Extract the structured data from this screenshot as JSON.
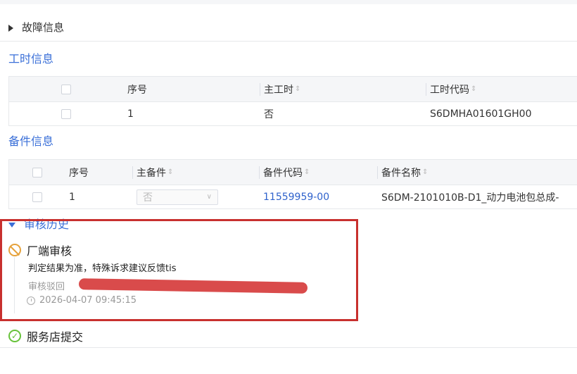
{
  "fault_section": {
    "label": "故障信息"
  },
  "labor_section": {
    "title": "工时信息",
    "columns": [
      "序号",
      "主工时",
      "工时代码"
    ],
    "rows": [
      {
        "index": "1",
        "main": "否",
        "code": "S6DMHA01601GH00"
      }
    ]
  },
  "parts_section": {
    "title": "备件信息",
    "columns": [
      "序号",
      "主备件",
      "备件代码",
      "备件名称"
    ],
    "rows": [
      {
        "index": "1",
        "main": "否",
        "code": "11559959-00",
        "name": "S6DM-2101010B-D1_动力电池包总成-"
      }
    ]
  },
  "history_section": {
    "title": "审核历史",
    "items": [
      {
        "title": "厂端审核",
        "note": "判定结果为准，特殊诉求建议反馈tis",
        "status": "审核驳回",
        "time": "2026-04-07 09:45:15"
      },
      {
        "title": "服务店提交"
      }
    ]
  },
  "colors": {
    "accent": "#3a6fd8",
    "link": "#2f62cc",
    "highlight_box": "#c8302e",
    "reject_icon": "#e6a23c",
    "submit_icon": "#67c23a"
  }
}
